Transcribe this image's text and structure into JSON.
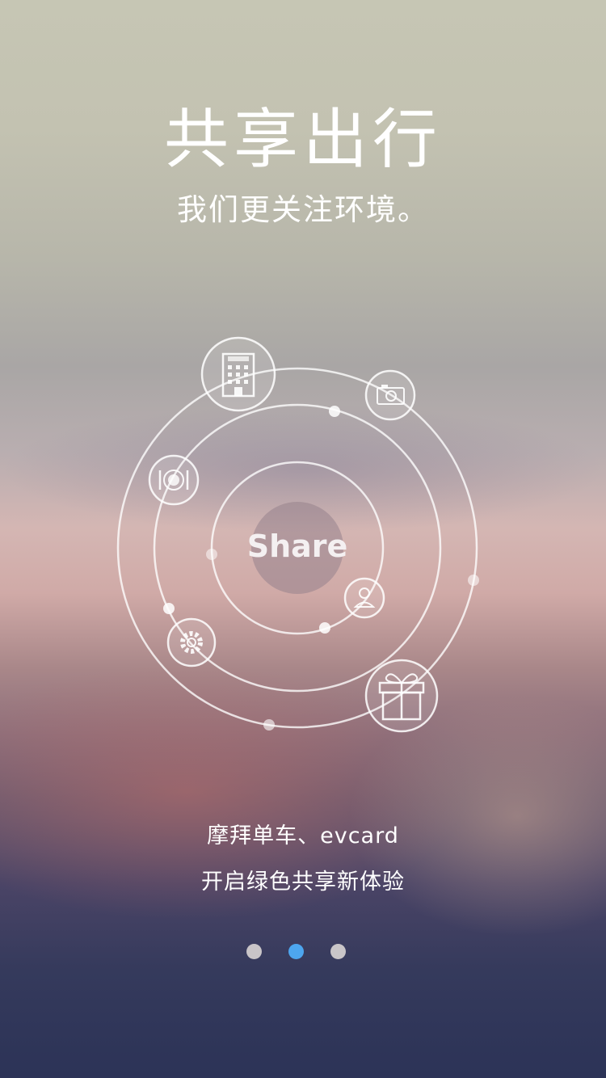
{
  "header": {
    "title": "共享出行",
    "subtitle": "我们更关注环境。"
  },
  "orbit": {
    "center_label": "Share",
    "icons": [
      "hotel-icon",
      "camera-icon",
      "dining-icon",
      "user-icon",
      "settings-icon",
      "gift-icon"
    ],
    "hotel_sign": "hotel"
  },
  "captions": {
    "line1": "摩拜单车、evcard",
    "line2": "开启绿色共享新体验"
  },
  "pagination": {
    "total": 3,
    "active_index": 1,
    "active_color": "#4da6ef",
    "inactive_color": "#c9c5c8"
  }
}
